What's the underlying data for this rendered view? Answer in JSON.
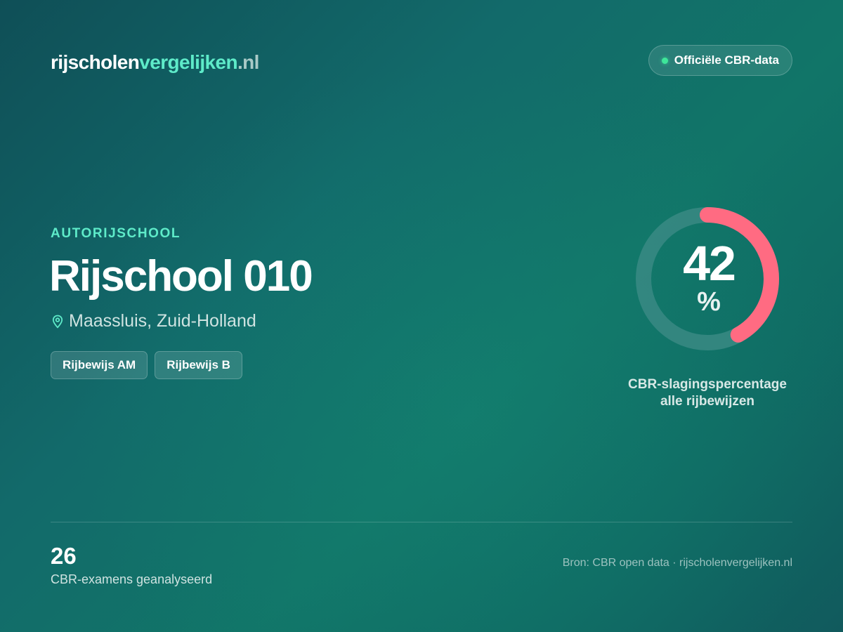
{
  "header": {
    "logo_part1": "rijscholen",
    "logo_part2": "vergelijken",
    "logo_part3": ".nl",
    "badge_label": "Officiële CBR-data"
  },
  "school": {
    "category": "AUTORIJSCHOOL",
    "name": "Rijschool 010",
    "location": "Maassluis, Zuid-Holland",
    "location_icon": "map-pin-icon",
    "licenses": [
      "Rijbewijs AM",
      "Rijbewijs B"
    ]
  },
  "pass_rate": {
    "value": 42,
    "value_label": "42",
    "unit": "%",
    "caption_line1": "CBR-slagingspercentage",
    "caption_line2": "alle rijbewijzen"
  },
  "footer": {
    "exam_count": "26",
    "exam_label": "CBR-examens geanalyseerd",
    "source": "Bron: CBR open data · rijscholenvergelijken.nl"
  },
  "colors": {
    "accent": "#5eebc9",
    "gauge_fill": "#ff6b82",
    "gauge_track": "#3a8a84",
    "status_dot": "#3ee69a"
  }
}
